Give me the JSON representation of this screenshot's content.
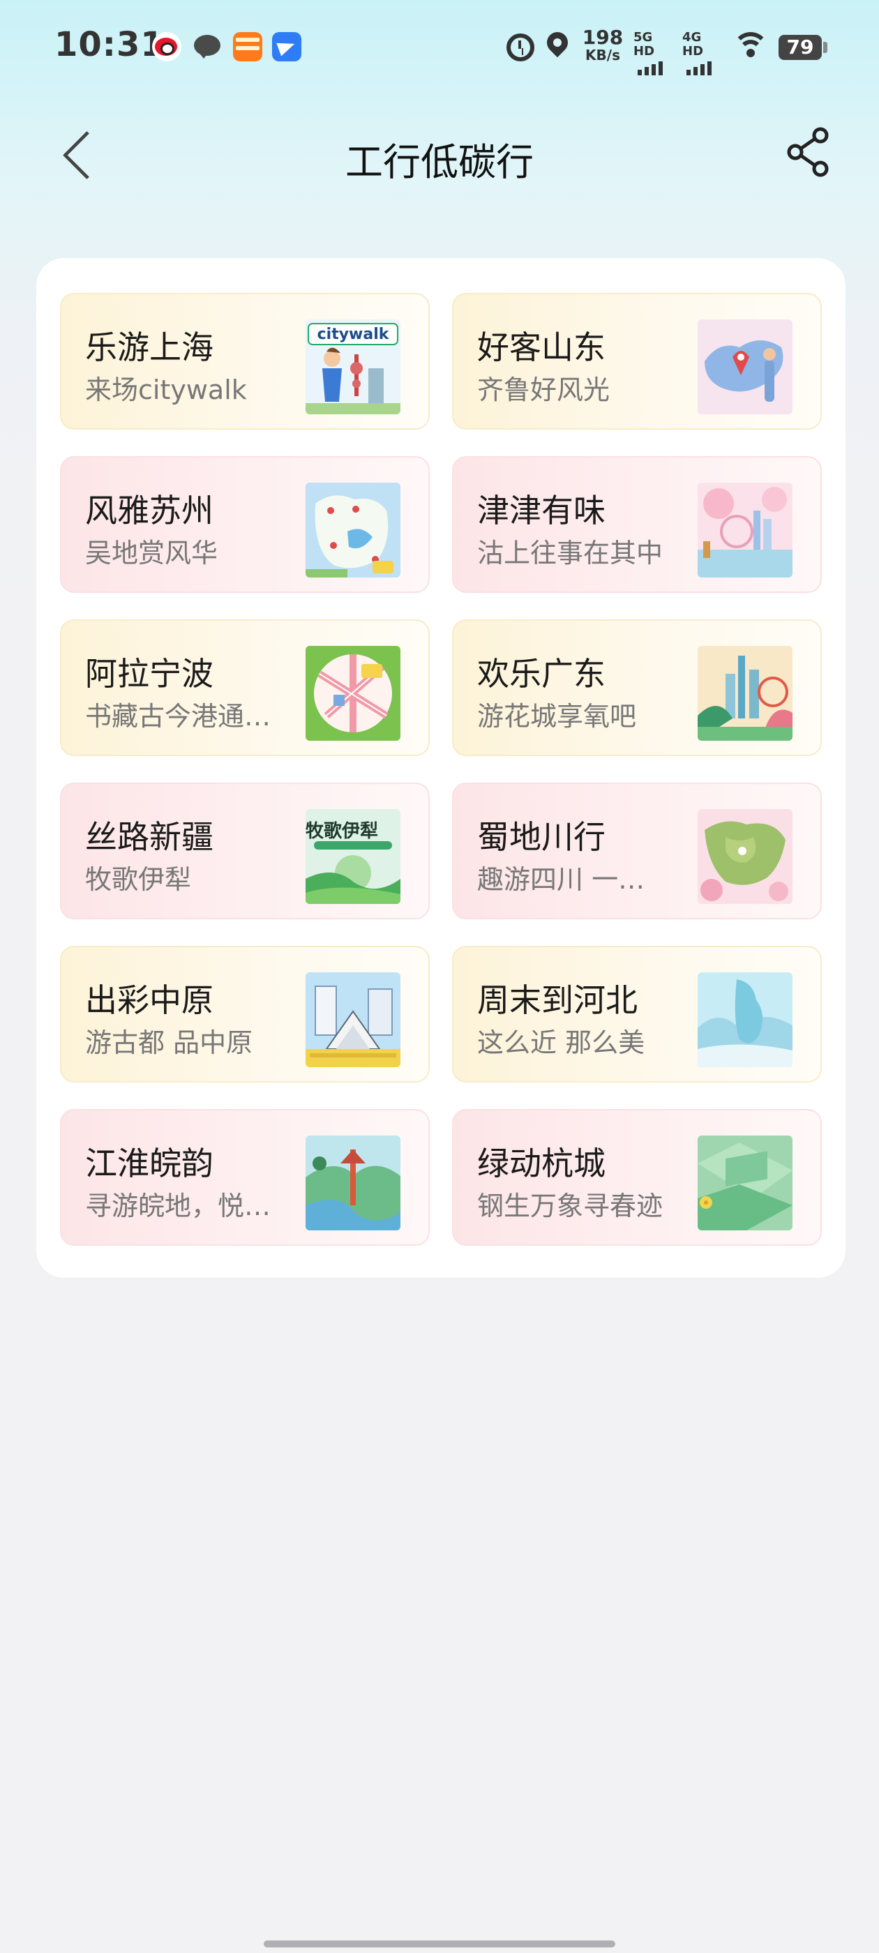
{
  "status_bar": {
    "time": "10:31",
    "net_speed_value": "198",
    "net_speed_unit": "KB/s",
    "signal1_label": "5G HD",
    "signal2_label": "4G HD",
    "battery": "79",
    "icons": [
      "weibo-icon",
      "chat-icon",
      "taobao-icon",
      "plane-icon",
      "alarm-icon",
      "location-icon",
      "signal-icon",
      "wifi-icon",
      "battery-icon"
    ]
  },
  "header": {
    "title": "工行低碳行",
    "back_icon": "chevron-left-icon",
    "share_icon": "share-icon"
  },
  "tiles": [
    {
      "title": "乐游上海",
      "subtitle": "来场citywalk",
      "style": "yellow",
      "image_text": "citywalk"
    },
    {
      "title": "好客山东",
      "subtitle": "齐鲁好风光",
      "style": "yellow"
    },
    {
      "title": "风雅苏州",
      "subtitle": "吴地赏风华",
      "style": "pink"
    },
    {
      "title": "津津有味",
      "subtitle": "沽上往事在其中",
      "style": "pink"
    },
    {
      "title": "阿拉宁波",
      "subtitle": "书藏古今港通…",
      "style": "yellow"
    },
    {
      "title": "欢乐广东",
      "subtitle": "游花城享氧吧",
      "style": "yellow"
    },
    {
      "title": "丝路新疆",
      "subtitle": "牧歌伊犁",
      "style": "pink",
      "image_text": "牧歌伊犁"
    },
    {
      "title": "蜀地川行",
      "subtitle": "趣游四川 一…",
      "style": "pink"
    },
    {
      "title": "出彩中原",
      "subtitle": "游古都 品中原",
      "style": "yellow"
    },
    {
      "title": "周末到河北",
      "subtitle": "这么近 那么美",
      "style": "yellow"
    },
    {
      "title": "江淮皖韵",
      "subtitle": "寻游皖地，悦…",
      "style": "pink"
    },
    {
      "title": "绿动杭城",
      "subtitle": "钢生万象寻春迹",
      "style": "pink"
    }
  ]
}
